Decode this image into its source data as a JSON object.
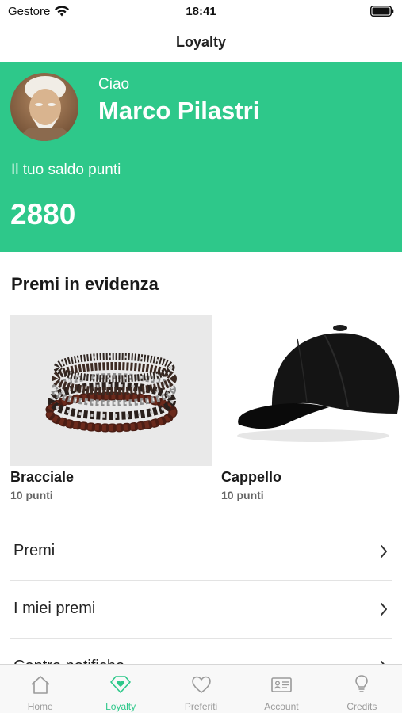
{
  "status_bar": {
    "carrier": "Gestore",
    "time": "18:41"
  },
  "nav": {
    "title": "Loyalty"
  },
  "hero": {
    "greeting": "Ciao",
    "user_name": "Marco Pilastri",
    "points_label": "Il tuo saldo punti",
    "points_value": "2880",
    "background_color": "#2ec88a"
  },
  "featured": {
    "title": "Premi in evidenza",
    "rewards": [
      {
        "name": "Bracciale",
        "points": "10 punti",
        "image": "bracelet"
      },
      {
        "name": "Cappello",
        "points": "10 punti",
        "image": "cap"
      }
    ]
  },
  "menu": {
    "items": [
      {
        "label": "Premi"
      },
      {
        "label": "I miei premi"
      },
      {
        "label": "Centro notifiche"
      }
    ]
  },
  "tab_bar": {
    "active_color": "#2ec88a",
    "tabs": [
      {
        "label": "Home",
        "icon": "home-icon"
      },
      {
        "label": "Loyalty",
        "icon": "loyalty-icon",
        "active": true
      },
      {
        "label": "Preferiti",
        "icon": "heart-icon"
      },
      {
        "label": "Account",
        "icon": "id-card-icon"
      },
      {
        "label": "Credits",
        "icon": "lightbulb-icon"
      }
    ]
  }
}
